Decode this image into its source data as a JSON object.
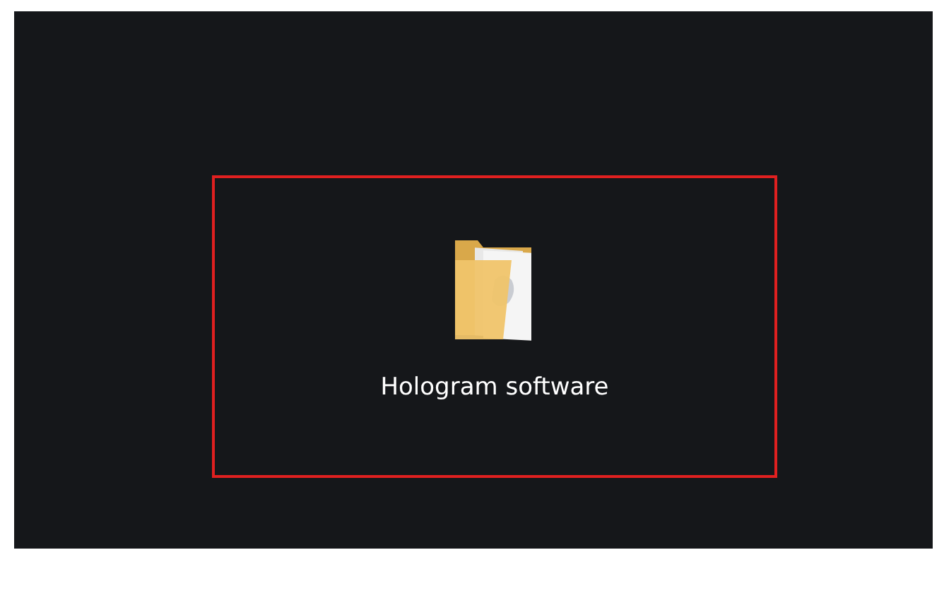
{
  "desktop": {
    "icons": [
      {
        "kind": "folder",
        "label": "Hologram software"
      }
    ]
  }
}
